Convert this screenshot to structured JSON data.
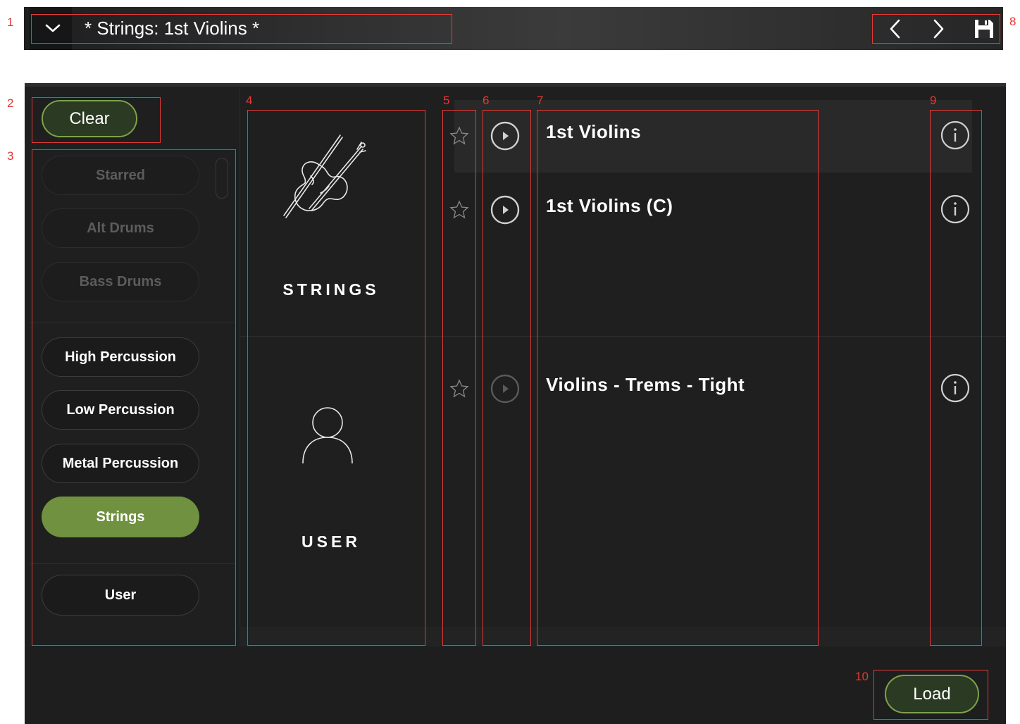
{
  "header": {
    "preset_title": "* Strings: 1st Violins *",
    "icons": [
      "chevron-down-icon",
      "chevron-left-icon",
      "chevron-right-icon",
      "save-icon"
    ]
  },
  "filters": {
    "clear_label": "Clear",
    "categories": [
      {
        "label": "Starred",
        "state": "disabled"
      },
      {
        "label": "Alt Drums",
        "state": "disabled"
      },
      {
        "label": "Bass Drums",
        "state": "disabled"
      },
      {
        "label": "High Percussion",
        "state": "enabled"
      },
      {
        "label": "Low Percussion",
        "state": "enabled"
      },
      {
        "label": "Metal Percussion",
        "state": "enabled"
      },
      {
        "label": "Strings",
        "state": "selected"
      },
      {
        "label": "User",
        "state": "enabled"
      }
    ]
  },
  "libraries": [
    {
      "label": "STRINGS",
      "icon": "violin-icon"
    },
    {
      "label": "USER",
      "icon": "user-icon"
    }
  ],
  "presets": [
    {
      "name": "1st Violins",
      "starred": false,
      "selected": true
    },
    {
      "name": "1st Violins (C)",
      "starred": false,
      "selected": false
    },
    {
      "name": "Violins - Trems - Tight",
      "starred": false,
      "selected": false
    }
  ],
  "footer": {
    "load_label": "Load"
  },
  "annotations": [
    "1",
    "2",
    "3",
    "4",
    "5",
    "6",
    "7",
    "8",
    "9",
    "10"
  ],
  "colors": {
    "accent": "#6f9140",
    "annotation": "#e53935",
    "background": "#1f1f1f"
  }
}
